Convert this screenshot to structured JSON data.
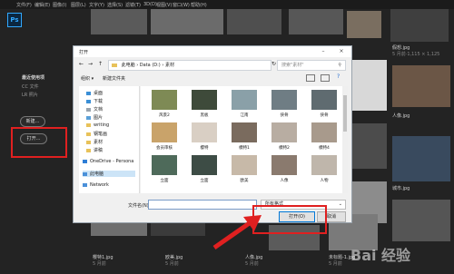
{
  "menu": [
    "文件(F)",
    "编辑(E)",
    "图像(I)",
    "图层(L)",
    "文字(Y)",
    "选择(S)",
    "滤镜(T)",
    "3D(D)",
    "视图(V)",
    "窗口(W)",
    "帮助(H)"
  ],
  "app_logo": "Ps",
  "left_panel": {
    "recent_heading": "最近使用项",
    "cc_files": "CC 文件",
    "lr_photos": "LR 照片",
    "new_button": "新建...",
    "open_button": "打开..."
  },
  "background_thumbs": [
    {
      "label": "假想.jpg",
      "meta": "5 月前·1,115 × 1,125"
    },
    {
      "label": "人像.jpg",
      "meta": "5 月前"
    },
    {
      "label": "城市.jpg",
      "meta": "5 月前"
    },
    {
      "label": "樱特1.jpg",
      "meta": "5 月前"
    },
    {
      "label": "欧美.jpg",
      "meta": "5 月前"
    },
    {
      "label": "人像.jpg",
      "meta": "5 月前"
    },
    {
      "label": "未标题-1.jpg",
      "meta": "5 月前"
    }
  ],
  "dialog": {
    "title": "打开",
    "breadcrumb": [
      "此电脑",
      "Data (D:)",
      "素材"
    ],
    "search_placeholder": "搜索\"素材\"",
    "organize": "组织 ▾",
    "new_folder": "新建文件夹",
    "nav_items": [
      "桌面",
      "下载",
      "文档",
      "图片",
      "writing",
      "钢笔画",
      "素材",
      "讲稿",
      "OneDrive - Persona",
      "此电脑",
      "Network"
    ],
    "files": [
      "风景2",
      "黑板",
      "江南",
      "侠骨",
      "侠骨",
      "会员审核",
      "樱特",
      "模特1",
      "模特2",
      "模特4",
      "立面",
      "立面",
      "欧美",
      "人像",
      "人物"
    ],
    "filename_label": "文件名(N):",
    "filetype_value": "所有格式",
    "open_label": "打开(O)",
    "cancel_label": "取消"
  },
  "watermark": "Bai 经验",
  "colors": {
    "highlight": "#e02020",
    "accent": "#31a8ff"
  }
}
